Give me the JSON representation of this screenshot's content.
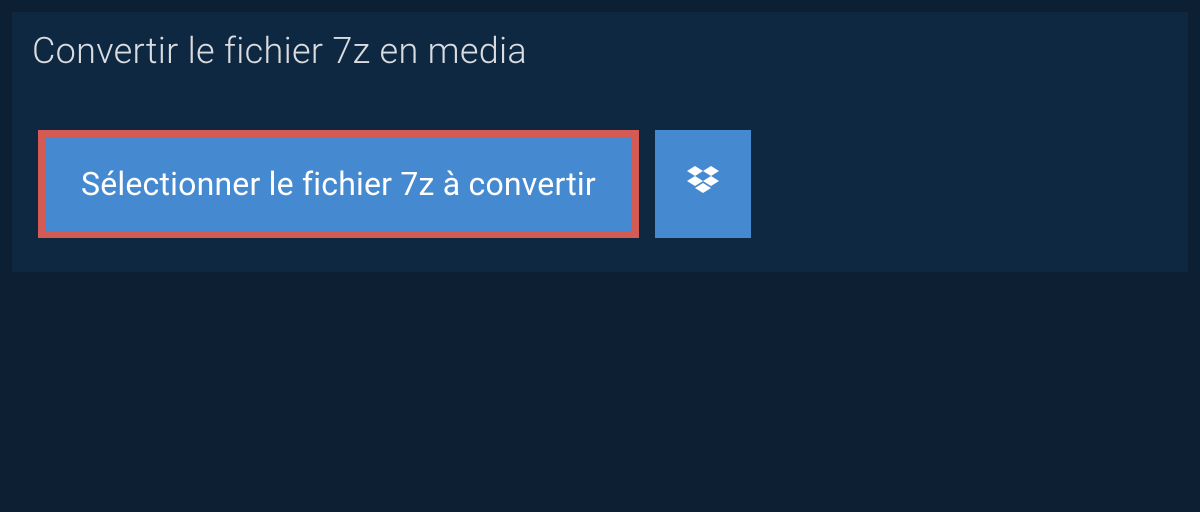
{
  "tab": {
    "title": "Convertir le fichier 7z en media"
  },
  "buttons": {
    "select_file_label": "Sélectionner le fichier 7z à convertir"
  }
}
